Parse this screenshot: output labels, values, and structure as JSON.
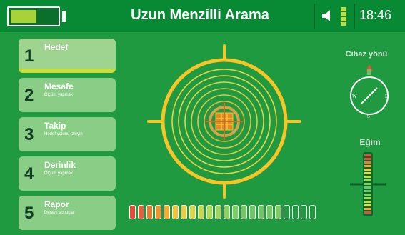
{
  "header": {
    "title": "Uzun Menzilli Arama",
    "time": "18:46",
    "battery_level": 0.55,
    "icons": {
      "battery": "battery-icon",
      "speaker": "speaker-icon",
      "signal": "signal-strength-icon"
    }
  },
  "menu": {
    "items": [
      {
        "number": "1",
        "label": "Hedef",
        "subtitle": "",
        "active": true
      },
      {
        "number": "2",
        "label": "Mesafe",
        "subtitle": "Ölçüm yapmak",
        "active": false
      },
      {
        "number": "3",
        "label": "Takip",
        "subtitle": "Hedef yolunu izleyin",
        "active": false
      },
      {
        "number": "4",
        "label": "Derinlik",
        "subtitle": "Ölçüm yapmak",
        "active": false
      },
      {
        "number": "5",
        "label": "Rapor",
        "subtitle": "Detaylı sonuçlar",
        "active": false
      }
    ]
  },
  "compass": {
    "label": "Cihaz yönü",
    "directions": {
      "w": "W",
      "e": "E",
      "s": "S"
    },
    "icon": "compass-icon"
  },
  "tilt": {
    "label": "Eğim",
    "icon": "tilt-gauge-icon"
  },
  "signal_strength": {
    "total_segments": 22,
    "filled_segments": 18,
    "icon": "signal-level-bar"
  },
  "colors": {
    "background": "#1f9a40",
    "topbar": "#088a34",
    "accent_yellow": "#f6c528",
    "menu_tile": "#89cd86",
    "active_underline": "#c8df3a"
  }
}
